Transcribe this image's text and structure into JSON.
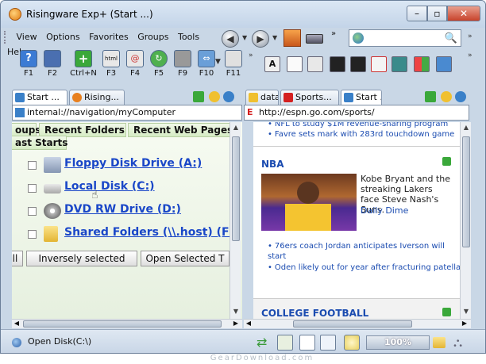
{
  "window": {
    "title": "Risingware Exp+  (Start ...)",
    "min": "–",
    "max": "▫",
    "close": "✕"
  },
  "menu": [
    "View",
    "Options",
    "Favorites",
    "Groups",
    "Tools",
    "Help"
  ],
  "nav": {
    "back": "◀",
    "forward": "▶",
    "more": "»"
  },
  "toolbar": [
    {
      "key": "F1",
      "icon": "help-icon",
      "color": "#3b7bd4"
    },
    {
      "key": "F2",
      "icon": "save-icon",
      "color": "#4a6fb0"
    },
    {
      "key": "Ctrl+N",
      "icon": "new-tab-icon",
      "color": "#3aa83a"
    },
    {
      "key": "F3",
      "icon": "html-icon",
      "color": "#e8e8e8"
    },
    {
      "key": "F4",
      "icon": "email-icon",
      "color": "#e8e8e8"
    },
    {
      "key": "F5",
      "icon": "refresh-icon",
      "color": "#4fb04f"
    },
    {
      "key": "F9",
      "icon": "print-icon",
      "color": "#999999"
    },
    {
      "key": "F10",
      "icon": "split-icon",
      "color": "#6a9fd8"
    },
    {
      "key": "F11",
      "icon": "window-icon",
      "color": "#e0e0e0"
    }
  ],
  "left": {
    "tabs": [
      "Start ...",
      "Rising..."
    ],
    "address": "internal://navigation/myComputer",
    "category_tabs": [
      "oups",
      "Recent Folders",
      "Recent Web Pages",
      "ast Starts"
    ],
    "drives": [
      {
        "label": "Floppy Disk Drive (A:)",
        "icon": "floppy-drive-icon"
      },
      {
        "label": "Local Disk (C:)",
        "icon": "hard-disk-icon"
      },
      {
        "label": "DVD RW Drive (D:)",
        "icon": "dvd-drive-icon"
      },
      {
        "label": "Shared Folders (\\\\.host) (F:)",
        "icon": "shared-folder-icon"
      }
    ],
    "buttons": [
      "ll",
      "Inversely selected",
      "Open Selected T"
    ]
  },
  "right": {
    "tabs": [
      "data",
      "Sports...",
      "Start ..."
    ],
    "address": "http://espn.go.com/sports/",
    "top_links": [
      "NFL to study $1M revenue-sharing program",
      "Favre sets mark with 283rd touchdown game"
    ],
    "nba": {
      "heading": "NBA",
      "caption": "Kobe Bryant and the streaking Lakers face Steve Nash's Suns.",
      "link": "Daily Dime",
      "headlines": [
        "76ers coach Jordan anticipates Iverson will start",
        "Oden likely out for year after fracturing patella"
      ]
    },
    "college": "COLLEGE FOOTBALL"
  },
  "status": {
    "text": "Open Disk(C:\\)",
    "zoom": "100%"
  },
  "watermark": "GearDownload.com"
}
